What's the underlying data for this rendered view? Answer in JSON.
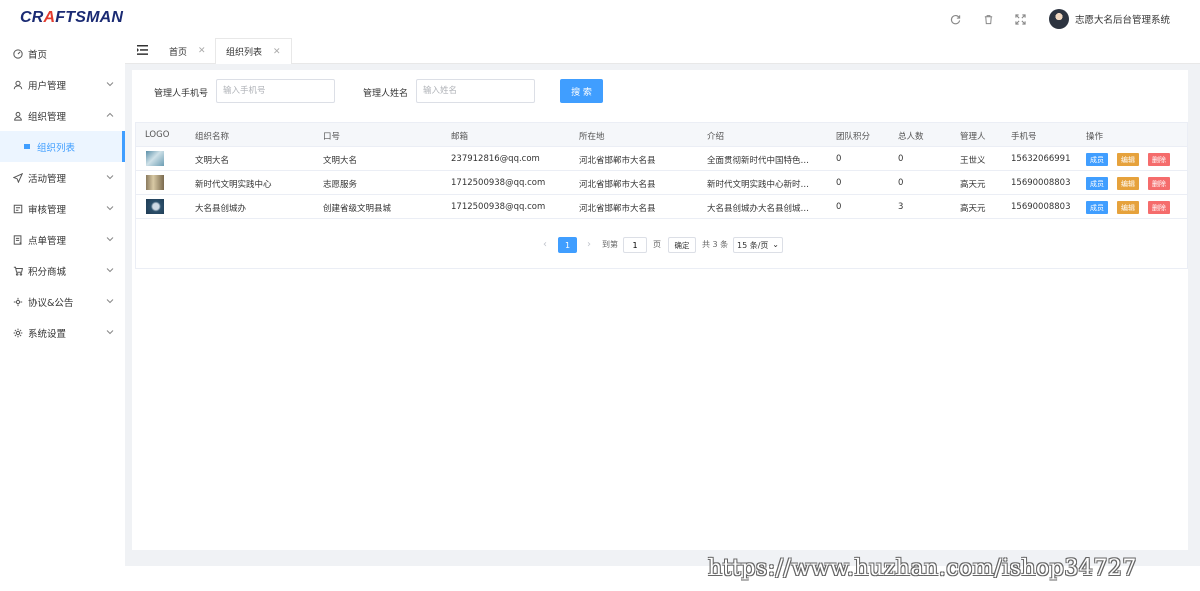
{
  "header": {
    "logo": {
      "part1": "CR",
      "part2": "A",
      "part3": "FTSMAN"
    },
    "icons": [
      "refresh-icon",
      "trash-icon",
      "fullscreen-icon"
    ],
    "user_name": "志愿大名后台管理系统"
  },
  "sidebar": {
    "items": [
      {
        "label": "首页",
        "icon": "dashboard-icon"
      },
      {
        "label": "用户管理",
        "icon": "user-icon"
      },
      {
        "label": "组织管理",
        "icon": "group-icon",
        "expanded": true
      },
      {
        "label": "组织列表",
        "icon": "list-icon",
        "active": true
      },
      {
        "label": "活动管理",
        "icon": "send-icon"
      },
      {
        "label": "审核管理",
        "icon": "audit-icon"
      },
      {
        "label": "点单管理",
        "icon": "order-icon"
      },
      {
        "label": "积分商城",
        "icon": "cart-icon"
      },
      {
        "label": "协议&公告",
        "icon": "notice-icon"
      },
      {
        "label": "系统设置",
        "icon": "settings-icon"
      }
    ]
  },
  "tabs": [
    {
      "label": "首页"
    },
    {
      "label": "组织列表",
      "active": true
    }
  ],
  "filters": {
    "phone_label": "管理人手机号",
    "phone_placeholder": "输入手机号",
    "name_label": "管理人姓名",
    "name_placeholder": "输入姓名",
    "search_label": "搜 索"
  },
  "table": {
    "columns": [
      "LOGO",
      "组织名称",
      "口号",
      "邮箱",
      "所在地",
      "介绍",
      "团队积分",
      "总人数",
      "管理人",
      "手机号",
      "操作"
    ],
    "rows": [
      {
        "name": "文明大名",
        "slogan": "文明大名",
        "email": "237912816@qq.com",
        "location": "河北省邯郸市大名县",
        "intro": "全面贯彻新时代中国特色…",
        "points": "0",
        "total": "0",
        "manager": "王世义",
        "phone": "15632066991"
      },
      {
        "name": "新时代文明实践中心",
        "slogan": "志愿服务",
        "email": "1712500938@qq.com",
        "location": "河北省邯郸市大名县",
        "intro": "新时代文明实践中心新时…",
        "points": "0",
        "total": "0",
        "manager": "高天元",
        "phone": "15690008803"
      },
      {
        "name": "大名县创城办",
        "slogan": "创建省级文明县城",
        "email": "1712500938@qq.com",
        "location": "河北省邯郸市大名县",
        "intro": "大名县创城办大名县创城…",
        "points": "0",
        "total": "3",
        "manager": "高天元",
        "phone": "15690008803"
      }
    ],
    "actions": {
      "members": "成员",
      "edit": "编辑",
      "delete": "删除"
    }
  },
  "pagination": {
    "current": "1",
    "goto_label": "到第",
    "goto_value": "1",
    "page_unit": "页",
    "confirm": "确定",
    "total": "共 3 条",
    "page_size": "15 条/页"
  },
  "watermark": "https://www.huzhan.com/ishop34727",
  "colors": {
    "primary": "#409eff",
    "edit": "#e6a23c",
    "delete": "#f56c6c",
    "members": "#409eff"
  }
}
